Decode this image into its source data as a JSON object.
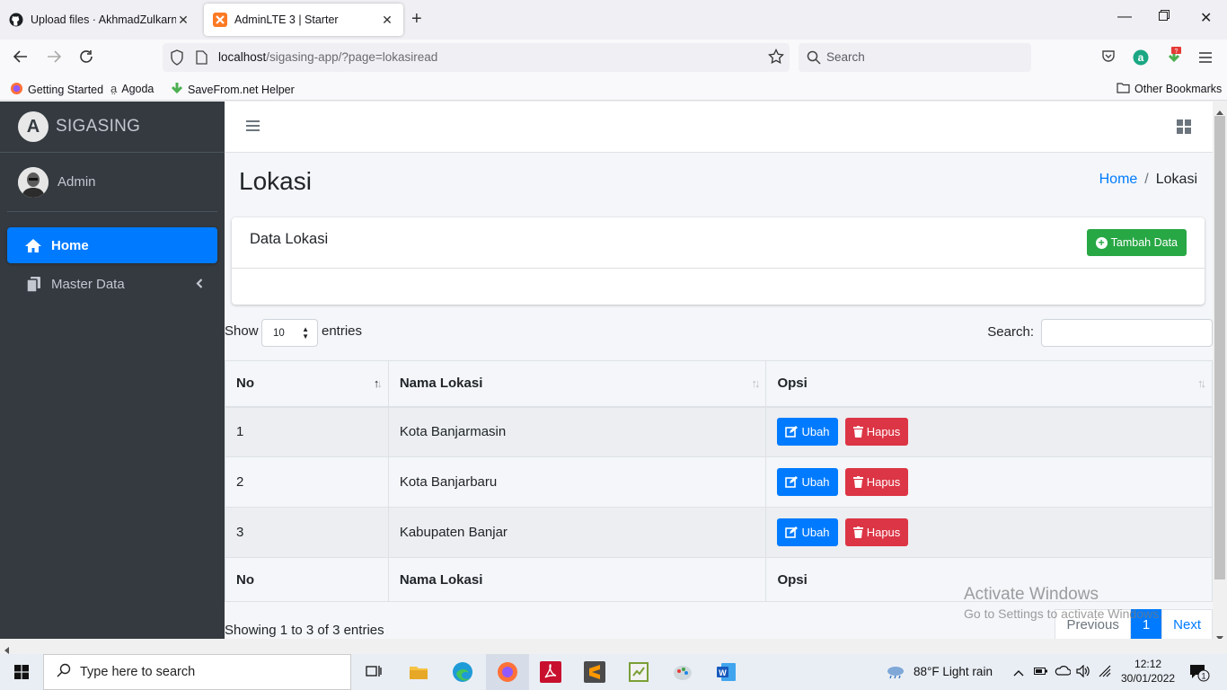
{
  "browser": {
    "tabs": [
      {
        "title": "Upload files · AkhmadZulkarnai",
        "active": false
      },
      {
        "title": "AdminLTE 3 | Starter",
        "active": true
      }
    ],
    "url_host": "localhost",
    "url_path": "/sigasing-app/?page=lokasiread",
    "search_placeholder": "Search",
    "bookmarks": [
      "Getting Started",
      "Agoda",
      "SaveFrom.net Helper"
    ],
    "other_bookmarks": "Other Bookmarks",
    "ext_badge": "?"
  },
  "sidebar": {
    "brand": "SIGASING",
    "brand_letter": "A",
    "user": "Admin",
    "items": [
      {
        "label": "Home",
        "active": true
      },
      {
        "label": "Master Data",
        "active": false
      }
    ]
  },
  "page": {
    "title": "Lokasi",
    "breadcrumb": [
      "Home",
      "Lokasi"
    ],
    "card_title": "Data Lokasi",
    "add_button": "Tambah Data",
    "show_label": "Show",
    "entries_value": "10",
    "entries_label": "entries",
    "search_label": "Search:"
  },
  "table": {
    "headers": [
      "No",
      "Nama Lokasi",
      "Opsi"
    ],
    "rows": [
      {
        "no": "1",
        "nama": "Kota Banjarmasin"
      },
      {
        "no": "2",
        "nama": "Kota Banjarbaru"
      },
      {
        "no": "3",
        "nama": "Kabupaten Banjar"
      }
    ],
    "edit_label": "Ubah",
    "delete_label": "Hapus",
    "info": "Showing 1 to 3 of 3 entries",
    "pager": {
      "prev": "Previous",
      "current": "1",
      "next": "Next"
    }
  },
  "watermark": {
    "title": "Activate Windows",
    "sub": "Go to Settings to activate Windows."
  },
  "taskbar": {
    "search": "Type here to search",
    "weather": "88°F  Light rain",
    "time": "12:12",
    "date": "30/01/2022",
    "notif_count": "1"
  },
  "colors": {
    "primary": "#007bff",
    "success": "#28a745",
    "danger": "#dc3545",
    "sidebar": "#343a40"
  }
}
